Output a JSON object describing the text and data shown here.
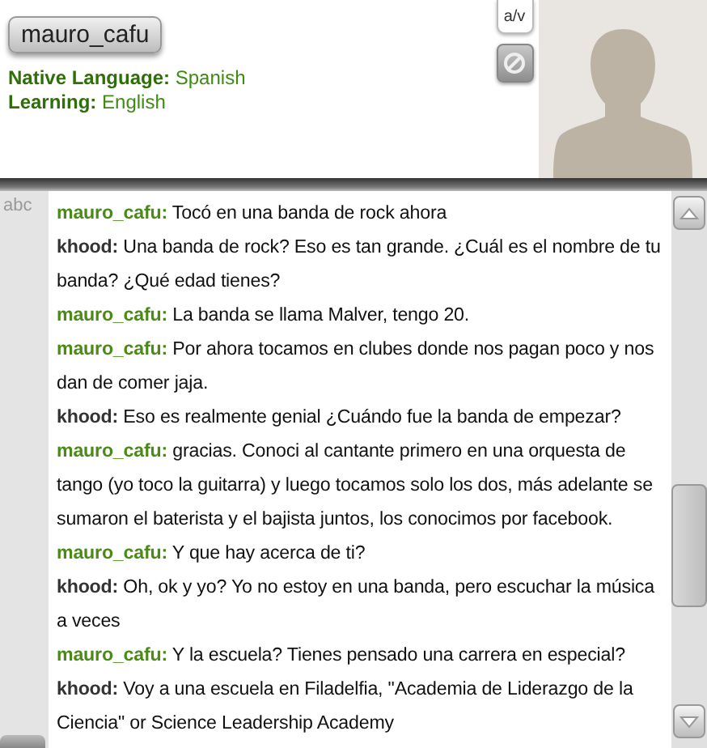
{
  "profile": {
    "username": "mauro_cafu",
    "native_language": {
      "label": "Native Language:",
      "value": "Spanish"
    },
    "learning": {
      "label": "Learning:",
      "value": "English"
    }
  },
  "av_button": "a/v",
  "chat": {
    "gutter_label": "abc",
    "messages": [
      {
        "sender": "mauro_cafu:",
        "kind": "partner",
        "text": "Tocó en una banda de rock ahora"
      },
      {
        "sender": "khood:",
        "kind": "self",
        "text": "Una banda de rock? Eso es tan grande. ¿Cuál es el nombre de tu banda? ¿Qué edad tienes?"
      },
      {
        "sender": "mauro_cafu:",
        "kind": "partner",
        "text": "La banda se llama Malver, tengo 20."
      },
      {
        "sender": "mauro_cafu:",
        "kind": "partner",
        "text": "Por ahora tocamos en clubes donde nos pagan poco y nos dan de comer jaja."
      },
      {
        "sender": "khood:",
        "kind": "self",
        "text": "Eso es realmente genial ¿Cuándo fue la banda de empezar?"
      },
      {
        "sender": "mauro_cafu:",
        "kind": "partner",
        "text": "gracias. Conoci al cantante primero en una orquesta de tango (yo toco la guitarra) y luego tocamos solo los dos, más adelante se sumaron el baterista y el bajista juntos, los conocimos por facebook."
      },
      {
        "sender": "mauro_cafu:",
        "kind": "partner",
        "text": "Y que hay acerca de ti?"
      },
      {
        "sender": "khood:",
        "kind": "self",
        "text": "Oh, ok y yo? Yo no estoy en una banda, pero escuchar la música a veces"
      },
      {
        "sender": "mauro_cafu:",
        "kind": "partner",
        "text": "Y la escuela? Tienes pensado una carrera en especial?"
      },
      {
        "sender": "khood:",
        "kind": "self",
        "text": "Voy a una escuela en Filadelfia, \"Academia de Liderazgo de la Ciencia\" or Science Leadership Academy"
      }
    ]
  }
}
